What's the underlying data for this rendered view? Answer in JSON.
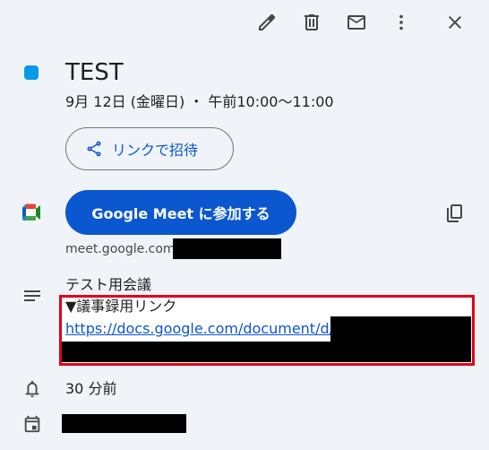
{
  "toolbar": {
    "edit_icon": "pencil-icon",
    "delete_icon": "trash-icon",
    "email_icon": "mail-icon",
    "more_icon": "more-vert-icon",
    "close_icon": "close-icon"
  },
  "event": {
    "color": "#039be5",
    "title": "TEST",
    "datetime": "9月 12日 (金曜日) ・ 午前10:00～11:00"
  },
  "invite": {
    "label": "リンクで招待",
    "icon": "share-icon"
  },
  "meet": {
    "button_label": "Google Meet に参加する",
    "url_prefix": "meet.google.com",
    "copy_icon": "copy-icon"
  },
  "description": {
    "line1": "テスト用会議",
    "line2": "▼議事録用リンク",
    "link": "https://docs.google.com/document/d/"
  },
  "reminder": {
    "text": "30 分前"
  },
  "colors": {
    "accent": "#0b57d0",
    "highlight": "#e0001b",
    "background": "#f0f4f9"
  }
}
